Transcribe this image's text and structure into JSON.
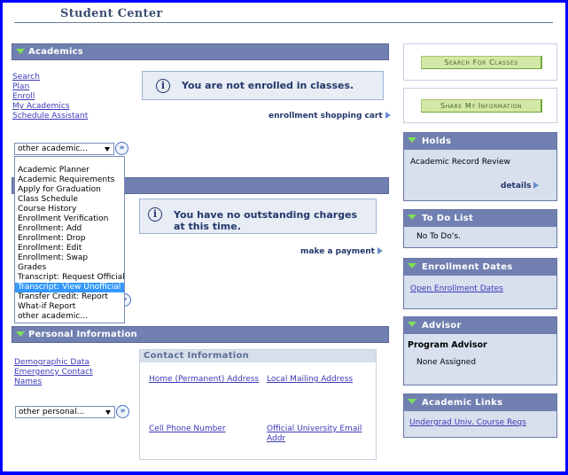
{
  "page": {
    "title": "Student Center",
    "frame_color": "#0000ff",
    "accent_bar_color": "#7180b1"
  },
  "academics": {
    "header": "Academics",
    "links": [
      "Search",
      "Plan",
      "Enroll",
      "My Academics",
      "Schedule Assistant"
    ],
    "info_message": "You are not enrolled in classes.",
    "shopping_cart_link": "enrollment shopping cart",
    "select": {
      "value": "other academic...",
      "expanded": true,
      "options": [
        "Academic Planner",
        "Academic Requirements",
        "Apply for Graduation",
        "Class Schedule",
        "Course History",
        "Enrollment Verification",
        "Enrollment: Add",
        "Enrollment: Drop",
        "Enrollment: Edit",
        "Enrollment: Swap",
        "Grades",
        "Transcript: Request Official",
        "Transcript: View Unofficial",
        "Transfer Credit: Report",
        "What-if Report",
        "other academic..."
      ],
      "highlighted_option": "Transcript: View Unofficial"
    }
  },
  "finances": {
    "info_message": "You have no outstanding charges at this time.",
    "payment_link": "make a payment"
  },
  "personal": {
    "header": "Personal Information",
    "links": [
      "Demographic Data",
      "Emergency Contact",
      "Names"
    ],
    "select": {
      "value": "other personal..."
    },
    "contact": {
      "header": "Contact Information",
      "links": [
        "Home (Permanent) Address",
        "Local Mailing Address",
        "Cell Phone Number",
        "Official University Email Addr"
      ]
    }
  },
  "sidebar": {
    "search_button": "Search For Classes",
    "share_button": "Share My Information",
    "holds": {
      "header": "Holds",
      "items": [
        "Academic Record Review"
      ],
      "details_link": "details"
    },
    "todo": {
      "header": "To Do List",
      "message": "No To Do's."
    },
    "enrollment_dates": {
      "header": "Enrollment Dates",
      "link": "Open Enrollment Dates"
    },
    "advisor": {
      "header": "Advisor",
      "label": "Program Advisor",
      "value": "None Assigned"
    },
    "academic_links": {
      "header": "Academic Links",
      "link": "Undergrad Univ. Course Reqs"
    }
  }
}
